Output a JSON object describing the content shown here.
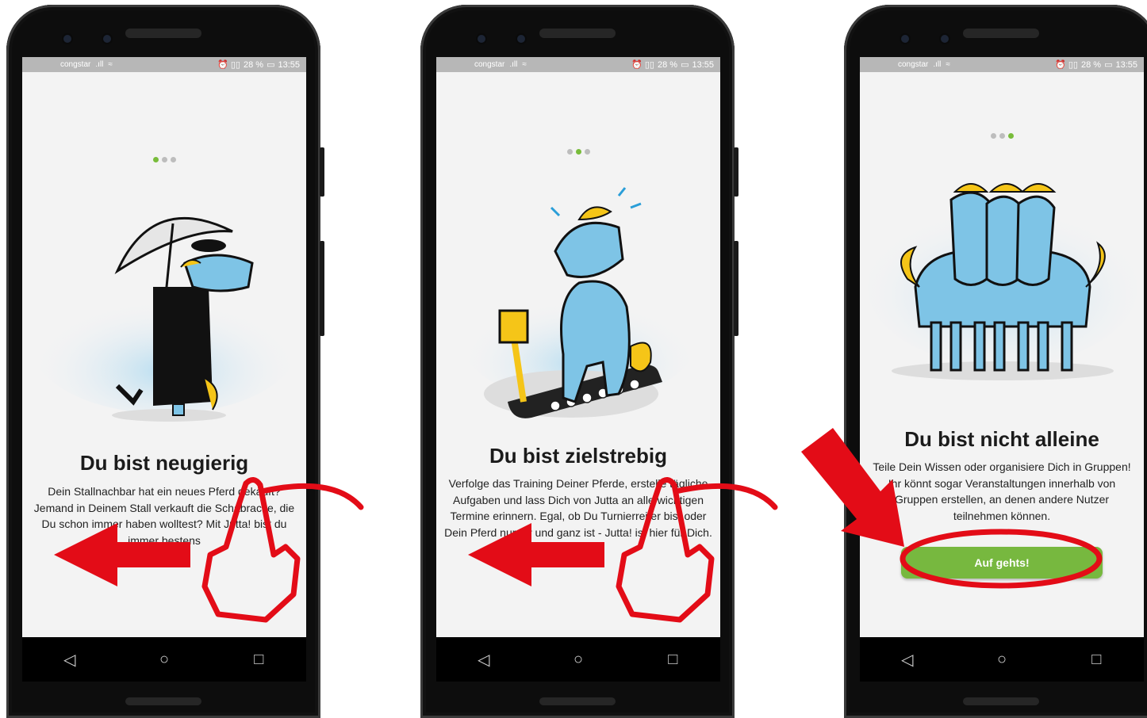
{
  "status": {
    "carrier": "congstar",
    "signal": ".ıll",
    "wifi": "≈",
    "icons": "⏰ ▯▯",
    "battery_pct": "28 %",
    "time": "13:55"
  },
  "screens": [
    {
      "title": "Du bist neugierig",
      "body": "Dein Stallnachbar hat ein neues Pferd gekauft? Jemand in Deinem Stall verkauft die Schabracke, die Du schon immer haben wolltest? Mit Jutta! bist du immer bestens",
      "active_dot": 0
    },
    {
      "title": "Du bist zielstrebig",
      "body": "Verfolge das Training Deiner Pferde, erstelle tägliche Aufgaben und lass Dich von Jutta an alle wichtigen Termine erinnern. Egal, ob Du Turnierreiter bist oder Dein Pferd nur für und ganz ist - Jutta! ist hier für Dich.",
      "active_dot": 1
    },
    {
      "title": "Du bist nicht alleine",
      "body": "Teile Dein Wissen oder organisiere Dich in Gruppen! Ihr könnt sogar Veranstaltungen innerhalb von Gruppen erstellen, an denen andere Nutzer teilnehmen können.",
      "active_dot": 2,
      "button": "Auf gehts!"
    }
  ],
  "navbar": {
    "back": "◁",
    "home": "○",
    "recent": "□"
  },
  "colors": {
    "accent_green": "#77b83f",
    "arrow_red": "#e30c17",
    "horse_blue": "#7ec4e6",
    "mane_yellow": "#f5c518"
  }
}
